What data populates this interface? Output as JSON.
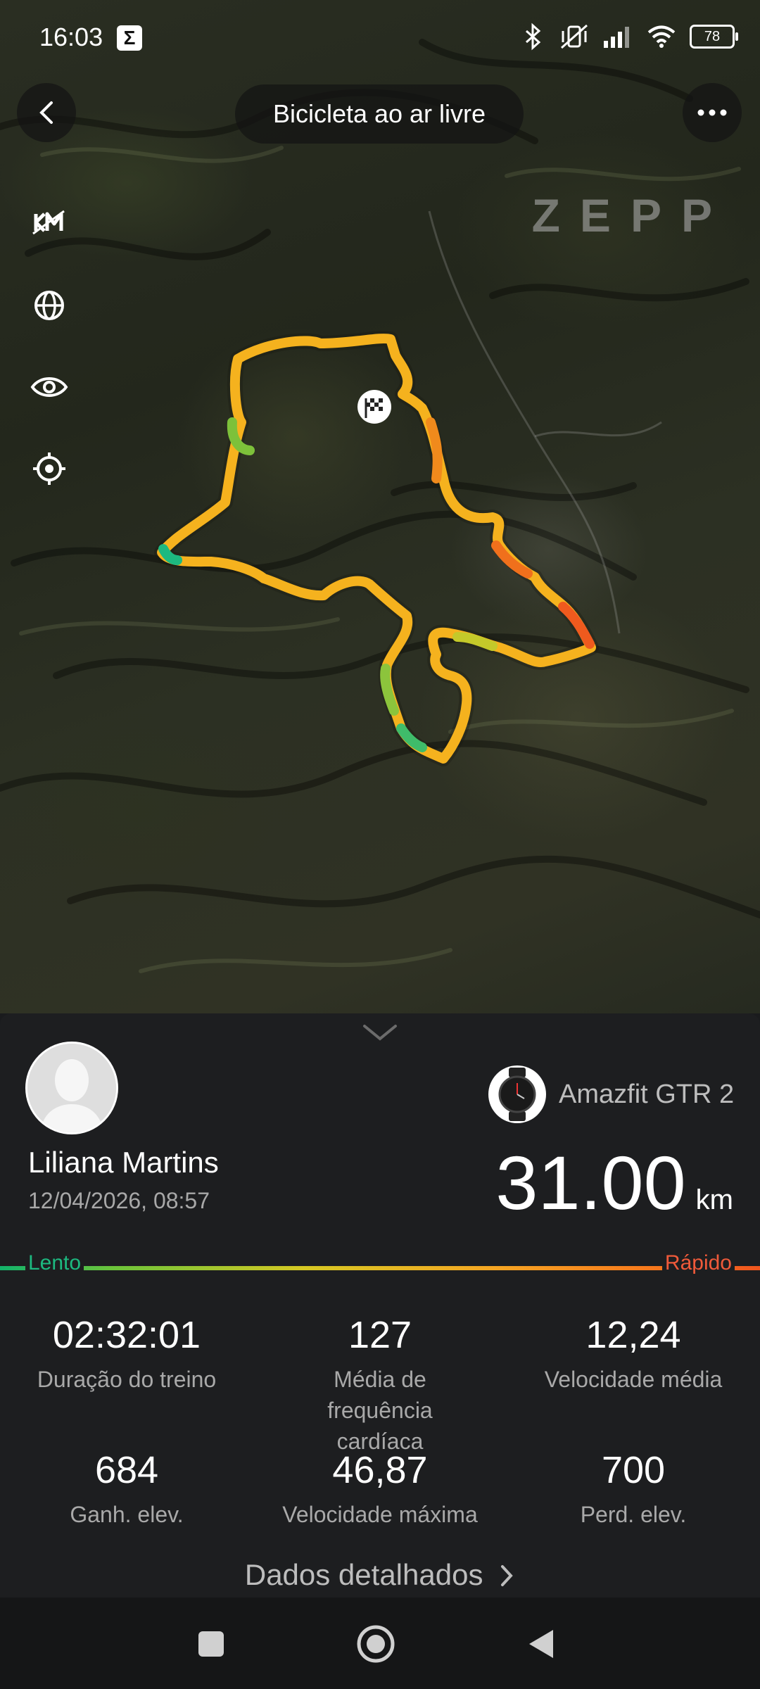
{
  "status_bar": {
    "time": "16:03",
    "battery": "78"
  },
  "header": {
    "title": "Bicicleta ao ar livre",
    "brand_watermark": "ZEPP"
  },
  "map": {
    "route_colors": {
      "slow": "#1db980",
      "mid": "#f5b01c",
      "fast": "#f05a1e"
    }
  },
  "profile": {
    "name": "Liliana Martins",
    "date": "12/04/2026, 08:57"
  },
  "device": {
    "name": "Amazfit GTR 2"
  },
  "distance": {
    "value": "31.00",
    "unit": "km"
  },
  "pace_bar": {
    "slow_label": "Lento",
    "fast_label": "Rápido"
  },
  "stats": [
    {
      "value": "02:32:01",
      "label": "Duração do treino"
    },
    {
      "value": "127",
      "label": "Média de frequência cardíaca"
    },
    {
      "value": "12,24",
      "label": "Velocidade média"
    },
    {
      "value": "684",
      "label": "Ganh. elev."
    },
    {
      "value": "46,87",
      "label": "Velocidade máxima"
    },
    {
      "value": "700",
      "label": "Perd. elev."
    }
  ],
  "details_link": "Dados detalhados"
}
